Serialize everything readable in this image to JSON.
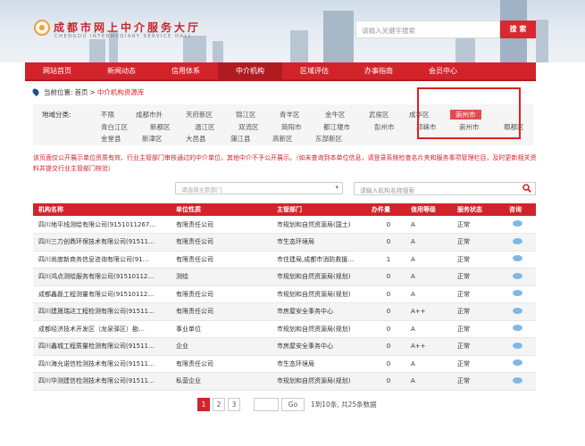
{
  "header": {
    "logo_cn": "成都市网上中介服务大厅",
    "logo_en": "CHENGDU INTERMEDIARY SERVICE HALL",
    "search_placeholder": "请输入关键字搜索",
    "search_button": "搜 索"
  },
  "nav": [
    {
      "label": "网站首页"
    },
    {
      "label": "新闻动态"
    },
    {
      "label": "信用体系"
    },
    {
      "label": "中介机构",
      "active": true
    },
    {
      "label": "区域评估"
    },
    {
      "label": "办事指南"
    },
    {
      "label": "会员中心"
    }
  ],
  "breadcrumb": {
    "label": "当前位置:",
    "home": "首页",
    "sep": ">",
    "current": "中介机构资源库"
  },
  "districts": {
    "label": "地域分类:",
    "items": [
      {
        "label": "不限"
      },
      {
        "label": "成都市外"
      },
      {
        "label": "天府新区"
      },
      {
        "label": "锦江区"
      },
      {
        "label": "青羊区"
      },
      {
        "label": "金牛区"
      },
      {
        "label": "武侯区"
      },
      {
        "label": "成华区"
      },
      {
        "label": "崇州市",
        "selected": true
      },
      {
        "label": "青白江区"
      },
      {
        "label": "新都区"
      },
      {
        "label": "温江区"
      },
      {
        "label": "双流区"
      },
      {
        "label": "简阳市"
      },
      {
        "label": "都江堰市"
      },
      {
        "label": "彭州市"
      },
      {
        "label": "邛崃市"
      },
      {
        "label": "崇州市"
      },
      {
        "label": "郫都区"
      },
      {
        "label": "金堂县"
      },
      {
        "label": "新津区"
      },
      {
        "label": "大邑县"
      },
      {
        "label": "蒲江县"
      },
      {
        "label": "高新区"
      },
      {
        "label": "东部新区"
      }
    ]
  },
  "note": "该页面仅公开展示单位资质有效、行业主管部门审核通过的中介单位，其他中介不予公开展示。（如未查询到本单位信息，请登录系统检查名片夹和服务事项管理栏目，及时更新相关资料并提交行业主管部门核验）",
  "filters": {
    "dept_placeholder": "请选择主管部门",
    "search_placeholder": "请输入机构名称搜索"
  },
  "table": {
    "headers": [
      "机构名称",
      "单位性质",
      "主管部门",
      "办件量",
      "信用等级",
      "服务状态",
      "咨询"
    ],
    "rows": [
      [
        "四川地平线测绘有限公司(9151011267…",
        "有限责任公司",
        "市规划和自然资源局(国土)",
        "0",
        "A",
        "正常"
      ],
      [
        "四川三力创鼎环保技术有限公司(91511…",
        "有限责任公司",
        "市生态环境局",
        "0",
        "A",
        "正常"
      ],
      [
        "四川尚度新商务信息咨询有限公司(91…",
        "有限责任公司",
        "市住建局,成都市消防救援…",
        "1",
        "A",
        "正常"
      ],
      [
        "四川鸿点测绘服务有限公司(91510112…",
        "测绘",
        "市规划和自然资源局(规划)",
        "0",
        "A",
        "正常"
      ],
      [
        "成都鑫磊工程测量有限公司(91510112…",
        "有限责任公司",
        "市规划和自然资源局(规划)",
        "0",
        "A",
        "正常"
      ],
      [
        "四川建晟瑞达工程检测有限公司(91511…",
        "有限责任公司",
        "市房屋安全事务中心",
        "0",
        "A++",
        "正常"
      ],
      [
        "成都经济技术开发区（龙泉驿区）勘…",
        "事业单位",
        "市规划和自然资源局(规划)",
        "0",
        "A",
        "正常"
      ],
      [
        "四川鑫城工程质量检测有限公司(91511…",
        "企业",
        "市房屋安全事务中心",
        "0",
        "A++",
        "正常"
      ],
      [
        "四川海允诺信检测技术有限公司(91511…",
        "有限责任公司",
        "市生态环境局",
        "0",
        "A",
        "正常"
      ],
      [
        "四川华测建信检测技术有限公司(91511…",
        "私营企业",
        "市规划和自然资源局(规划)",
        "0",
        "A",
        "正常"
      ]
    ]
  },
  "pagination": {
    "pages": [
      "1",
      "2",
      "3"
    ],
    "current": "1",
    "go": "Go",
    "info": "1到10条, 共25条数据"
  },
  "colors": {
    "primary": "#d2232a",
    "accent_dark": "#b01b20",
    "highlight": "#e02020"
  }
}
